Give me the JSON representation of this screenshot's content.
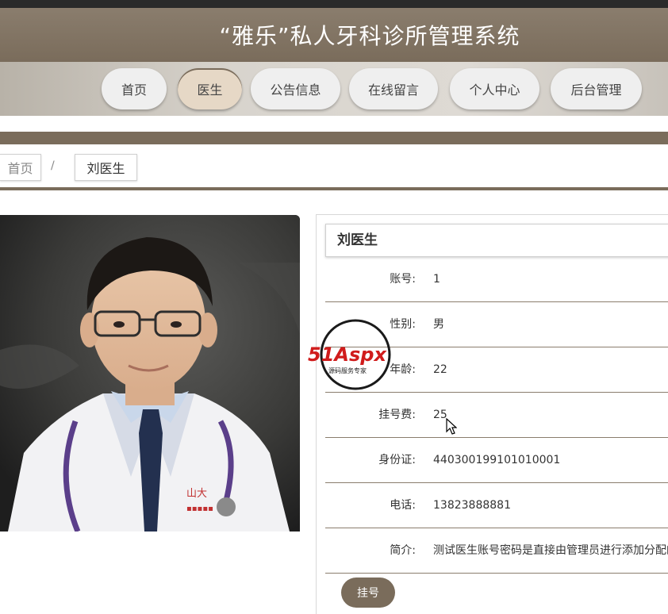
{
  "header": {
    "title": "“雅乐”私人牙科诊所管理系统"
  },
  "nav": {
    "items": [
      {
        "label": "首页"
      },
      {
        "label": "医生"
      },
      {
        "label": "公告信息"
      },
      {
        "label": "在线留言"
      },
      {
        "label": "个人中心"
      },
      {
        "label": "后台管理"
      }
    ]
  },
  "breadcrumb": {
    "home": "首页",
    "separator": "/",
    "current": "刘医生"
  },
  "doctor": {
    "name": "刘医生",
    "fields": [
      {
        "label": "账号:",
        "value": "1"
      },
      {
        "label": "性别:",
        "value": "男"
      },
      {
        "label": "年龄:",
        "value": "22"
      },
      {
        "label": "挂号费:",
        "value": "25"
      },
      {
        "label": "身份证:",
        "value": "440300199101010001"
      },
      {
        "label": "电话:",
        "value": "13823888881"
      },
      {
        "label": "简介:",
        "value": "测试医生账号密码是直接由管理员进行添加分配的"
      }
    ],
    "book_label": "挂号",
    "coat_text": "山大"
  },
  "watermark": {
    "brand": "51Aspx",
    "tagline": "源码服务专家"
  },
  "colors": {
    "brand": "#7a6c5b",
    "active_nav": "#e6d8c6"
  }
}
